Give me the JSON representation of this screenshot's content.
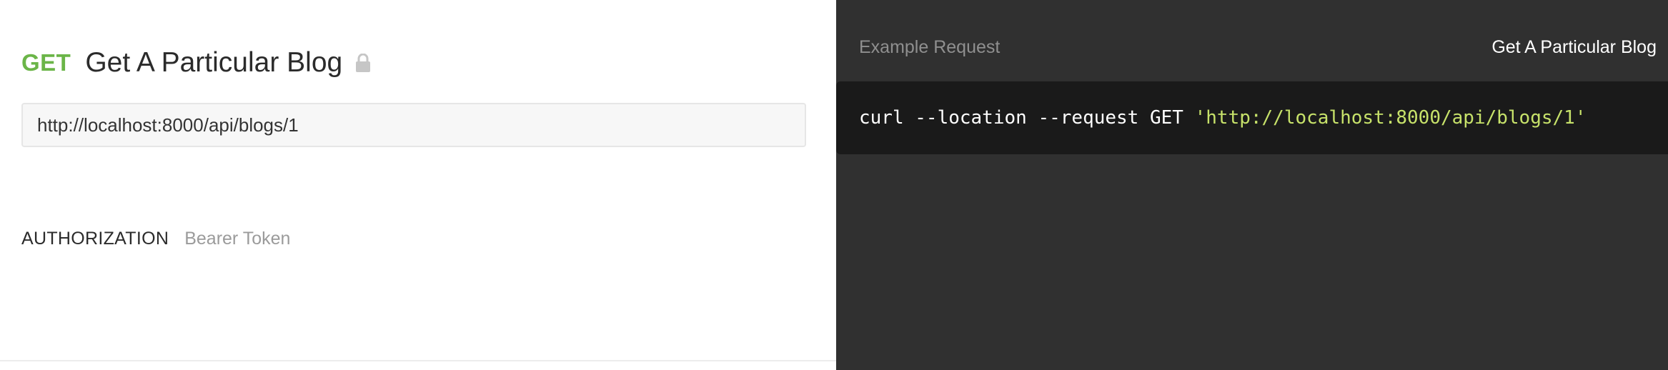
{
  "request": {
    "method": "GET",
    "title": "Get A Particular Blog",
    "url": "http://localhost:8000/api/blogs/1",
    "auth_label": "AUTHORIZATION",
    "auth_value": "Bearer Token",
    "lock_icon": "lock-icon"
  },
  "example": {
    "label": "Example Request",
    "name": "Get A Particular Blog",
    "code_command": "curl --location --request GET ",
    "code_url": "'http://localhost:8000/api/blogs/1'"
  },
  "colors": {
    "method_get": "#6bb548",
    "panel_bg": "#303030",
    "code_bg": "#1a1a1a",
    "code_string": "#c7e26a"
  }
}
